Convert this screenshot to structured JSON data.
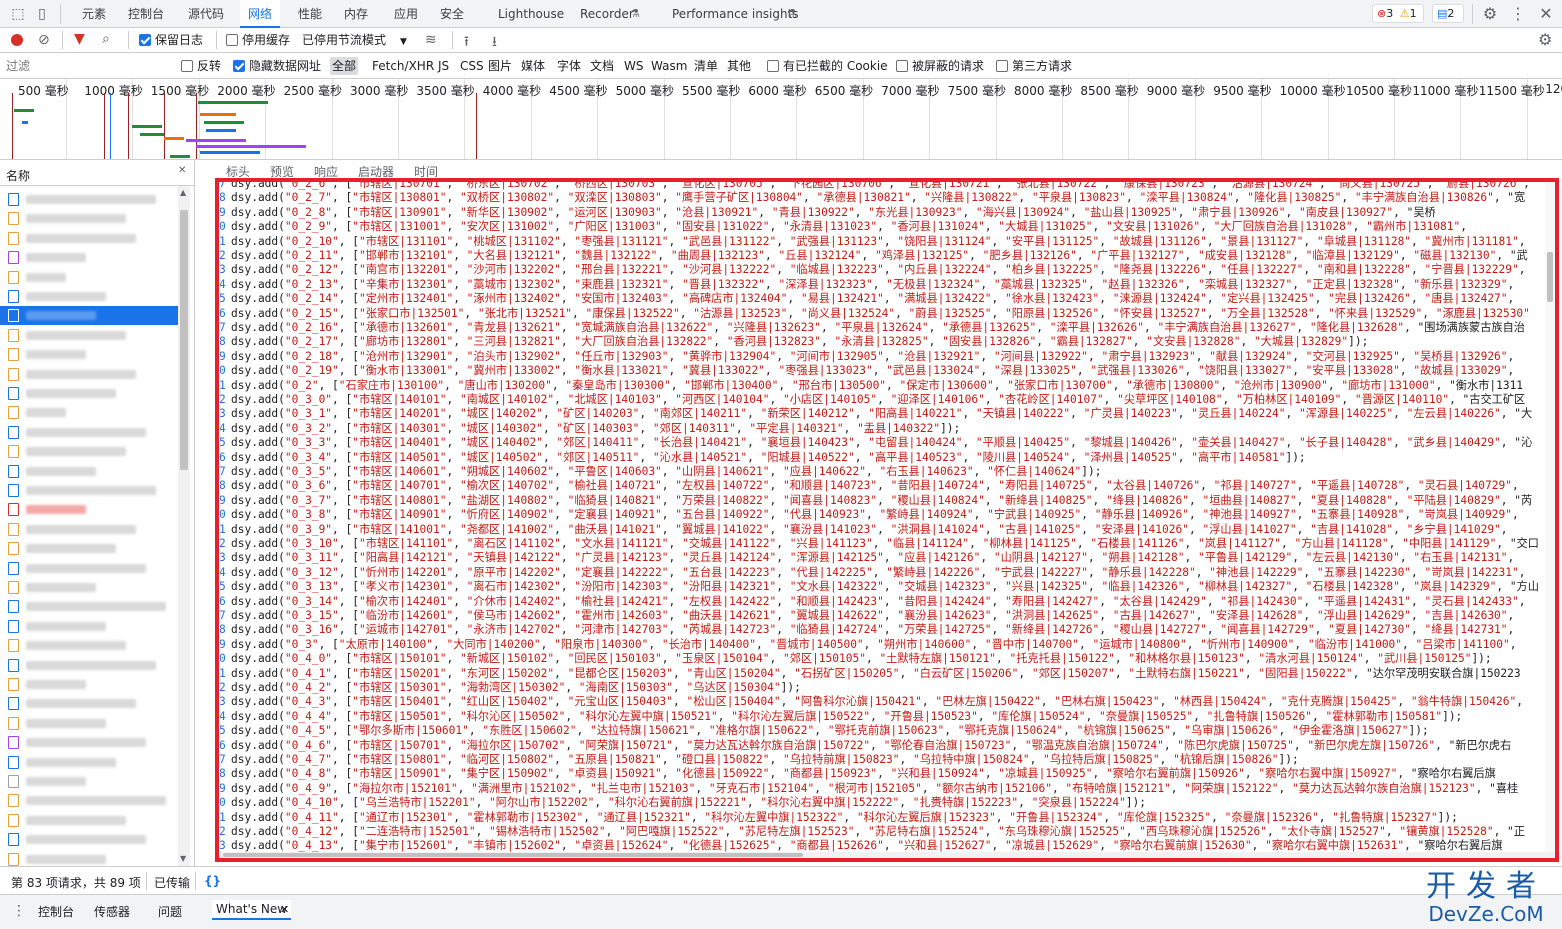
{
  "main_tabs": [
    "元素",
    "控制台",
    "源代码",
    "网络",
    "性能",
    "内存",
    "应用",
    "安全",
    "Lighthouse",
    "Recorder",
    "Performance insights"
  ],
  "active_tab": "网络",
  "badges": {
    "errors": "3",
    "warnings": "1",
    "messages": "2"
  },
  "toolbar": {
    "preserve_log": "保留日志",
    "disable_cache": "停用缓存",
    "throttling": "已停用节流模式"
  },
  "filter": {
    "placeholder": "过滤",
    "invert": "反转",
    "hide_data_urls": "隐藏数据网址",
    "types": [
      "全部",
      "Fetch/XHR",
      "JS",
      "CSS",
      "图片",
      "媒体",
      "字体",
      "文档",
      "WS",
      "Wasm",
      "清单",
      "其他"
    ],
    "blocked_cookies": "有已拦截的 Cookie",
    "blocked_requests": "被屏蔽的请求",
    "third_party": "第三方请求"
  },
  "timeline_ticks": [
    "500 毫秒",
    "1000 毫秒",
    "1500 毫秒",
    "2000 毫秒",
    "2500 毫秒",
    "3000 毫秒",
    "3500 毫秒",
    "4000 毫秒",
    "4500 毫秒",
    "5000 毫秒",
    "5500 毫秒",
    "6000 毫秒",
    "6500 毫秒",
    "7000 毫秒",
    "7500 毫秒",
    "8000 毫秒",
    "8500 毫秒",
    "9000 毫秒",
    "9500 毫秒",
    "10000 毫秒",
    "10500 毫秒",
    "11000 毫秒",
    "11500 毫秒",
    "1200"
  ],
  "list_header": "名称",
  "detail_tabs": [
    "标头",
    "预览",
    "响应",
    "启动器",
    "时间"
  ],
  "code_lines": [
    [
      "7",
      "dsy.add(\"0_2_6\", [\"市辖区|130701\", \"桥东区|130702\", \"桥西区|130703\", \"宣化区|130705\", \"下花园区|130706\", \"宣化县|130721\", \"张北县|130722\", \"康保县|130723\", \"沽源县|130724\", \"尚义县|130725\", \"蔚县|130726\","
    ],
    [
      "8",
      "dsy.add(\"0_2_7\", [\"市辖区|130801\", \"双桥区|130802\", \"双滦区|130803\", \"鹰手营子矿区|130804\", \"承德县|130821\", \"兴隆县|130822\", \"平泉县|130823\", \"滦平县|130824\", \"隆化县|130825\", \"丰宁满族自治县|130826\", \"宽"
    ],
    [
      "9",
      "dsy.add(\"0_2_8\", [\"市辖区|130901\", \"新华区|130902\", \"运河区|130903\", \"沧县|130921\", \"青县|130922\", \"东光县|130923\", \"海兴县|130924\", \"盐山县|130925\", \"肃宁县|130926\", \"南皮县|130927\", \"吴桥"
    ],
    [
      "0",
      "dsy.add(\"0_2_9\", [\"市辖区|131001\", \"安次区|131002\", \"广阳区|131003\", \"固安县|131022\", \"永清县|131023\", \"香河县|131024\", \"大城县|131025\", \"文安县|131026\", \"大厂回族自治县|131028\", \"霸州市|131081\","
    ],
    [
      "1",
      "dsy.add(\"0_2_10\", [\"市辖区|131101\", \"桃城区|131102\", \"枣强县|131121\", \"武邑县|131122\", \"武强县|131123\", \"饶阳县|131124\", \"安平县|131125\", \"故城县|131126\", \"景县|131127\", \"阜城县|131128\", \"冀州市|131181\","
    ],
    [
      "2",
      "dsy.add(\"0_2_11\", [\"邯郸市|132101\", \"大名县|132121\", \"魏县|132122\", \"曲周县|132123\", \"丘县|132124\", \"鸡泽县|132125\", \"肥乡县|132126\", \"广平县|132127\", \"成安县|132128\", \"临漳县|132129\", \"磁县|132130\", \"武"
    ],
    [
      "3",
      "dsy.add(\"0_2_12\", [\"南宫市|132201\", \"沙河市|132202\", \"邢台县|132221\", \"沙河县|132222\", \"临城县|132223\", \"内丘县|132224\", \"柏乡县|132225\", \"隆尧县|132226\", \"任县|132227\", \"南和县|132228\", \"宁晋县|132229\","
    ],
    [
      "4",
      "dsy.add(\"0_2_13\", [\"辛集市|132301\", \"藁城市|132302\", \"束鹿县|132321\", \"晋县|132322\", \"深泽县|132323\", \"无极县|132324\", \"藁城县|132325\", \"赵县|132326\", \"栾城县|132327\", \"正定县|132328\", \"新乐县|132329\","
    ],
    [
      "5",
      "dsy.add(\"0_2_14\", [\"定州市|132401\", \"涿州市|132402\", \"安国市|132403\", \"高碑店市|132404\", \"易县|132421\", \"满城县|132422\", \"徐水县|132423\", \"涞源县|132424\", \"定兴县|132425\", \"完县|132426\", \"唐县|132427\","
    ],
    [
      "6",
      "dsy.add(\"0_2_15\", [\"张家口市|132501\", \"张北市|132521\", \"康保县|132522\", \"沽源县|132523\", \"尚义县|132524\", \"蔚县|132525\", \"阳原县|132526\", \"怀安县|132527\", \"万全县|132528\", \"怀来县|132529\", \"涿鹿县|132530\""
    ],
    [
      "7",
      "dsy.add(\"0_2_16\", [\"承德市|132601\", \"青龙县|132621\", \"宽城满族自治县|132622\", \"兴隆县|132623\", \"平泉县|132624\", \"承德县|132625\", \"滦平县|132626\", \"丰宁满族自治县|132627\", \"隆化县|132628\", \"围场满族蒙古族自治"
    ],
    [
      "8",
      "dsy.add(\"0_2_17\", [\"廊坊市|132801\", \"三河县|132821\", \"大厂回族自治县|132822\", \"香河县|132823\", \"永清县|132825\", \"固安县|132826\", \"霸县|132827\", \"文安县|132828\", \"大城县|132829\"]);"
    ],
    [
      "9",
      "dsy.add(\"0_2_18\", [\"沧州市|132901\", \"泊头市|132902\", \"任丘市|132903\", \"黄骅市|132904\", \"河间市|132905\", \"沧县|132921\", \"河间县|132922\", \"肃宁县|132923\", \"献县|132924\", \"交河县|132925\", \"吴桥县|132926\","
    ],
    [
      "0",
      "dsy.add(\"0_2_19\", [\"衡水市|133001\", \"冀州市|133002\", \"衡水县|133021\", \"冀县|133022\", \"枣强县|133023\", \"武邑县|133024\", \"深县|133025\", \"武强县|133026\", \"饶阳县|133027\", \"安平县|133028\", \"故城县|133029\","
    ],
    [
      "1",
      "dsy.add(\"0_2\", [\"石家庄市|130100\", \"唐山市|130200\", \"秦皇岛市|130300\", \"邯郸市|130400\", \"邢台市|130500\", \"保定市|130600\", \"张家口市|130700\", \"承德市|130800\", \"沧州市|130900\", \"廊坊市|131000\", \"衡水市|1311"
    ],
    [
      "2",
      "dsy.add(\"0_3_0\", [\"市辖区|140101\", \"南城区|140102\", \"北城区|140103\", \"河西区|140104\", \"小店区|140105\", \"迎泽区|140106\", \"杏花岭区|140107\", \"尖草坪区|140108\", \"万柏林区|140109\", \"晋源区|140110\", \"古交工矿区"
    ],
    [
      "3",
      "dsy.add(\"0_3_1\", [\"市辖区|140201\", \"城区|140202\", \"矿区|140203\", \"南郊区|140211\", \"新荣区|140212\", \"阳高县|140221\", \"天镇县|140222\", \"广灵县|140223\", \"灵丘县|140224\", \"浑源县|140225\", \"左云县|140226\", \"大"
    ],
    [
      "4",
      "dsy.add(\"0_3_2\", [\"市辖区|140301\", \"城区|140302\", \"矿区|140303\", \"郊区|140311\", \"平定县|140321\", \"盂县|140322\"]);"
    ],
    [
      "5",
      "dsy.add(\"0_3_3\", [\"市辖区|140401\", \"城区|140402\", \"郊区|140411\", \"长治县|140421\", \"襄垣县|140423\", \"屯留县|140424\", \"平顺县|140425\", \"黎城县|140426\", \"壶关县|140427\", \"长子县|140428\", \"武乡县|140429\", \"沁"
    ],
    [
      "6",
      "dsy.add(\"0_3_4\", [\"市辖区|140501\", \"城区|140502\", \"郊区|140511\", \"沁水县|140521\", \"阳城县|140522\", \"高平县|140523\", \"陵川县|140524\", \"泽州县|140525\", \"高平市|140581\"]);"
    ],
    [
      "7",
      "dsy.add(\"0_3_5\", [\"市辖区|140601\", \"朔城区|140602\", \"平鲁区|140603\", \"山阴县|140621\", \"应县|140622\", \"右玉县|140623\", \"怀仁县|140624\"]);"
    ],
    [
      "8",
      "dsy.add(\"0_3_6\", [\"市辖区|140701\", \"榆次区|140702\", \"榆社县|140721\", \"左权县|140722\", \"和顺县|140723\", \"昔阳县|140724\", \"寿阳县|140725\", \"太谷县|140726\", \"祁县|140727\", \"平遥县|140728\", \"灵石县|140729\","
    ],
    [
      "9",
      "dsy.add(\"0_3_7\", [\"市辖区|140801\", \"盐湖区|140802\", \"临猗县|140821\", \"万荣县|140822\", \"闻喜县|140823\", \"稷山县|140824\", \"新绛县|140825\", \"绛县|140826\", \"垣曲县|140827\", \"夏县|140828\", \"平陆县|140829\", \"芮"
    ],
    [
      "0",
      "dsy.add(\"0_3_8\", [\"市辖区|140901\", \"忻府区|140902\", \"定襄县|140921\", \"五台县|140922\", \"代县|140923\", \"繁峙县|140924\", \"宁武县|140925\", \"静乐县|140926\", \"神池县|140927\", \"五寨县|140928\", \"岢岚县|140929\","
    ],
    [
      "1",
      "dsy.add(\"0_3_9\", [\"市辖区|141001\", \"尧都区|141002\", \"曲沃县|141021\", \"翼城县|141022\", \"襄汾县|141023\", \"洪洞县|141024\", \"古县|141025\", \"安泽县|141026\", \"浮山县|141027\", \"吉县|141028\", \"乡宁县|141029\","
    ],
    [
      "2",
      "dsy.add(\"0_3_10\", [\"市辖区|141101\", \"离石区|141102\", \"文水县|141121\", \"交城县|141122\", \"兴县|141123\", \"临县|141124\", \"柳林县|141125\", \"石楼县|141126\", \"岚县|141127\", \"方山县|141128\", \"中阳县|141129\", \"交口"
    ],
    [
      "3",
      "dsy.add(\"0_3_11\", [\"阳高县|142121\", \"天镇县|142122\", \"广灵县|142123\", \"灵丘县|142124\", \"浑源县|142125\", \"应县|142126\", \"山阴县|142127\", \"朔县|142128\", \"平鲁县|142129\", \"左云县|142130\", \"右玉县|142131\","
    ],
    [
      "4",
      "dsy.add(\"0_3_12\", [\"忻州市|142201\", \"原平市|142202\", \"定襄县|142222\", \"五台县|142223\", \"代县|142225\", \"繁峙县|142226\", \"宁武县|142227\", \"静乐县|142228\", \"神池县|142229\", \"五寨县|142230\", \"岢岚县|142231\","
    ],
    [
      "5",
      "dsy.add(\"0_3_13\", [\"孝义市|142301\", \"离石市|142302\", \"汾阳市|142303\", \"汾阳县|142321\", \"文水县|142322\", \"交城县|142323\", \"兴县|142325\", \"临县|142326\", \"柳林县|142327\", \"石楼县|142328\", \"岚县|142329\", \"方山"
    ],
    [
      "6",
      "dsy.add(\"0_3_14\", [\"榆次市|142401\", \"介休市|142402\", \"榆社县|142421\", \"左权县|142422\", \"和顺县|142423\", \"昔阳县|142424\", \"寿阳县|142427\", \"太谷县|142429\", \"祁县|142430\", \"平遥县|142431\", \"灵石县|142433\","
    ],
    [
      "7",
      "dsy.add(\"0_3_15\", [\"临汾市|142601\", \"侯马市|142602\", \"霍州市|142603\", \"曲沃县|142621\", \"翼城县|142622\", \"襄汾县|142623\", \"洪洞县|142625\", \"古县|142627\", \"安泽县|142628\", \"浮山县|142629\", \"吉县|142630\","
    ],
    [
      "8",
      "dsy.add(\"0_3_16\", [\"运城市|142701\", \"永济市|142702\", \"河津市|142703\", \"芮城县|142723\", \"临猗县|142724\", \"万荣县|142725\", \"新绛县|142726\", \"稷山县|142727\", \"闻喜县|142729\", \"夏县|142730\", \"绛县|142731\","
    ],
    [
      "9",
      "dsy.add(\"0_3\", [\"太原市|140100\", \"大同市|140200\", \"阳泉市|140300\", \"长治市|140400\", \"晋城市|140500\", \"朔州市|140600\", \"晋中市|140700\", \"运城市|140800\", \"忻州市|140900\", \"临汾市|141000\", \"吕梁市|141100\","
    ],
    [
      "0",
      "dsy.add(\"0_4_0\", [\"市辖区|150101\", \"新城区|150102\", \"回民区|150103\", \"玉泉区|150104\", \"郊区|150105\", \"土默特左旗|150121\", \"托克托县|150122\", \"和林格尔县|150123\", \"清水河县|150124\", \"武川县|150125\"]);"
    ],
    [
      "1",
      "dsy.add(\"0_4_1\", [\"市辖区|150201\", \"东河区|150202\", \"昆都仑区|150203\", \"青山区|150204\", \"石拐矿区|150205\", \"白云矿区|150206\", \"郊区|150207\", \"土默特右旗|150221\", \"固阳县|150222\", \"达尔罕茂明安联合旗|150223"
    ],
    [
      "2",
      "dsy.add(\"0_4_2\", [\"市辖区|150301\", \"海勃湾区|150302\", \"海南区|150303\", \"乌达区|150304\"]);"
    ],
    [
      "3",
      "dsy.add(\"0_4_3\", [\"市辖区|150401\", \"红山区|150402\", \"元宝山区|150403\", \"松山区|150404\", \"阿鲁科尔沁旗|150421\", \"巴林左旗|150422\", \"巴林右旗|150423\", \"林西县|150424\", \"克什克腾旗|150425\", \"翁牛特旗|150426\","
    ],
    [
      "4",
      "dsy.add(\"0_4_4\", [\"市辖区|150501\", \"科尔沁区|150502\", \"科尔沁左翼中旗|150521\", \"科尔沁左翼后旗|150522\", \"开鲁县|150523\", \"库伦旗|150524\", \"奈曼旗|150525\", \"扎鲁特旗|150526\", \"霍林郭勒市|150581\"]);"
    ],
    [
      "5",
      "dsy.add(\"0_4_5\", [\"鄂尔多斯市|150601\", \"东胜区|150602\", \"达拉特旗|150621\", \"准格尔旗|150622\", \"鄂托克前旗|150623\", \"鄂托克旗|150624\", \"杭锦旗|150625\", \"乌审旗|150626\", \"伊金霍洛旗|150627\"]);"
    ],
    [
      "6",
      "dsy.add(\"0_4_6\", [\"市辖区|150701\", \"海拉尔区|150702\", \"阿荣旗|150721\", \"莫力达瓦达斡尔族自治旗|150722\", \"鄂伦春自治旗|150723\", \"鄂温克族自治旗|150724\", \"陈巴尔虎旗|150725\", \"新巴尔虎左旗|150726\", \"新巴尔虎右"
    ],
    [
      "7",
      "dsy.add(\"0_4_7\", [\"市辖区|150801\", \"临河区|150802\", \"五原县|150821\", \"磴口县|150822\", \"乌拉特前旗|150823\", \"乌拉特中旗|150824\", \"乌拉特后旗|150825\", \"杭锦后旗|150826\"]);"
    ],
    [
      "8",
      "dsy.add(\"0_4_8\", [\"市辖区|150901\", \"集宁区|150902\", \"卓资县|150921\", \"化德县|150922\", \"商都县|150923\", \"兴和县|150924\", \"凉城县|150925\", \"察哈尔右翼前旗|150926\", \"察哈尔右翼中旗|150927\", \"察哈尔右翼后旗"
    ],
    [
      "9",
      "dsy.add(\"0_4_9\", [\"海拉尔市|152101\", \"满洲里市|152102\", \"扎兰屯市|152103\", \"牙克石市|152104\", \"根河市|152105\", \"额尔古纳市|152106\", \"布特哈旗|152121\", \"阿荣旗|152122\", \"莫力达瓦达斡尔族自治旗|152123\", \"喜桂"
    ],
    [
      "0",
      "dsy.add(\"0_4_10\", [\"乌兰浩特市|152201\", \"阿尔山市|152202\", \"科尔沁右翼前旗|152221\", \"科尔沁右翼中旗|152222\", \"扎赉特旗|152223\", \"突泉县|152224\"]);"
    ],
    [
      "1",
      "dsy.add(\"0_4_11\", [\"通辽市|152301\", \"霍林郭勒市|152302\", \"通辽县|152321\", \"科尔沁左翼中旗|152322\", \"科尔沁左翼后旗|152323\", \"开鲁县|152324\", \"库伦旗|152325\", \"奈曼旗|152326\", \"扎鲁特旗|152327\"]);"
    ],
    [
      "2",
      "dsy.add(\"0_4_12\", [\"二连浩特市|152501\", \"锡林浩特市|152502\", \"阿巴嘎旗|152522\", \"苏尼特左旗|152523\", \"苏尼特右旗|152524\", \"东乌珠穆沁旗|152525\", \"西乌珠穆沁旗|152526\", \"太仆寺旗|152527\", \"镶黄旗|152528\", \"正"
    ],
    [
      "3",
      "dsy.add(\"0_4_13\", [\"集宁市|152601\", \"丰镇市|152602\", \"卓资县|152624\", \"化德县|152625\", \"商都县|152626\", \"兴和县|152627\", \"凉城县|152629\", \"察哈尔右翼前旗|152630\", \"察哈尔右翼中旗|152631\", \"察哈尔右翼后旗"
    ]
  ],
  "status": {
    "requests": "第 83 项请求，共 89 项",
    "transferred": "已传输",
    "pretty_print": "{}"
  },
  "drawer_tabs": [
    "控制台",
    "传感器",
    "问题",
    "What's New"
  ],
  "watermark": {
    "cn": "开发者",
    "en": "DevZe.CoM"
  }
}
